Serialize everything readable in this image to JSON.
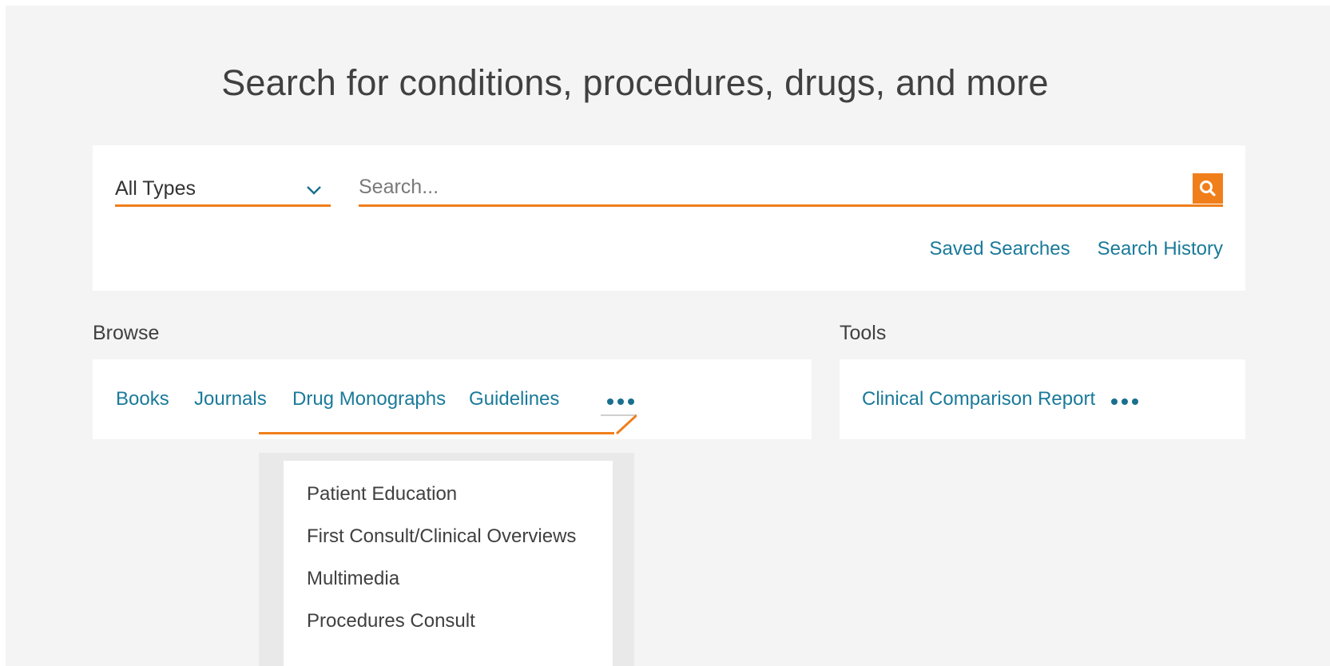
{
  "heading": "Search for conditions, procedures, drugs, and more",
  "search": {
    "type_select": {
      "selected": "All Types"
    },
    "placeholder": "Search...",
    "saved_searches": "Saved Searches",
    "search_history": "Search History"
  },
  "browse": {
    "label": "Browse",
    "links": [
      "Books",
      "Journals",
      "Drug Monographs",
      "Guidelines"
    ],
    "more_menu": [
      "Patient Education",
      "First Consult/Clinical Overviews",
      "Multimedia",
      "Procedures Consult"
    ]
  },
  "tools": {
    "label": "Tools",
    "links": [
      "Clinical Comparison Report"
    ]
  },
  "icons": {
    "type_select": "chevron-down-icon",
    "search_button": "search-icon",
    "more": "more-dots-icon"
  },
  "colors": {
    "accent": "#f07f1b",
    "link": "#1a7a9a",
    "text": "#404040",
    "background": "#f4f4f4"
  }
}
